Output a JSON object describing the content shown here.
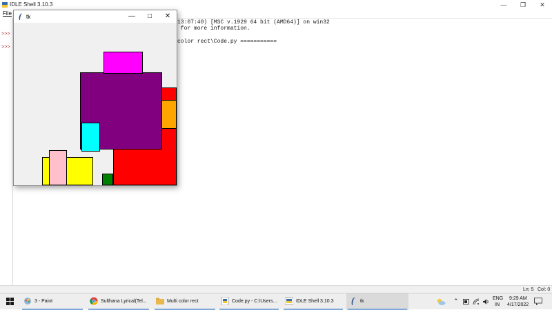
{
  "idle": {
    "title": "IDLE Shell 3.10.3",
    "menu_file": "File",
    "prompts": [
      ">>>",
      ">>>"
    ],
    "lines": [
      "13:07:40) [MSC v.1929 64 bit (AMD64)] on win32",
      " for more information.",
      "color rect\\Code.py ==========="
    ],
    "status_line": "Ln: 5",
    "status_col": "Col: 0"
  },
  "tk_window": {
    "title": "tk",
    "rect_colors": {
      "magenta": "#ff00ff",
      "purple": "#800080",
      "red": "#ff0000",
      "orange": "#ffa500",
      "cyan": "#00ffff",
      "yellow": "#ffff00",
      "pink": "#ffc0cb",
      "green": "#008000"
    }
  },
  "taskbar": {
    "items": [
      {
        "label": "3 - Paint",
        "icon": "paint-icon"
      },
      {
        "label": "Sulthana Lyrical(Tel...",
        "icon": "chrome-icon"
      },
      {
        "label": "Multi color rect",
        "icon": "folder-icon"
      },
      {
        "label": "Code.py - C:\\Users...",
        "icon": "python-file-icon"
      },
      {
        "label": "IDLE Shell 3.10.3",
        "icon": "idle-icon"
      },
      {
        "label": "tk",
        "icon": "tk-feather-icon"
      }
    ],
    "lang": "ENG",
    "region": "IN",
    "time": "9:29 AM",
    "date": "4/17/2022"
  }
}
